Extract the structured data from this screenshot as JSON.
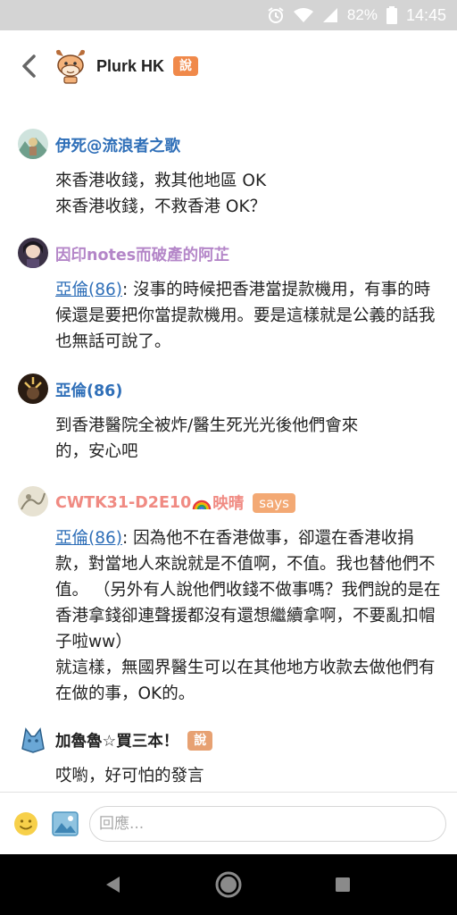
{
  "status_bar": {
    "battery": "82%",
    "time": "14:45",
    "icons": [
      "alarm-icon",
      "wifi-icon",
      "signal-icon",
      "battery-icon"
    ]
  },
  "header": {
    "title": "Plurk HK",
    "qualifier": "說",
    "qualifier_color": "#f0894a"
  },
  "responses": [
    {
      "name": "伊死@流浪者之歌",
      "name_color": "#2f6fb8",
      "lines": [
        "來香港收錢，救其他地區 OK",
        "來香港收錢，不救香港 OK？"
      ]
    },
    {
      "name": "因印notes而破產的阿芷",
      "name_color": "#b486c8",
      "mention": "亞倫(86)",
      "text": ": 沒事的時候把香港當提款機用，有事的時候還是要把你當提款機用。要是這樣就是公義的話我也無話可說了。"
    },
    {
      "name": "亞倫(86)",
      "name_color": "#2f6fb8",
      "lines": [
        "到香港醫院全被炸/醫生死光光後他們會來",
        "的，安心吧"
      ]
    },
    {
      "name": "CWTK31-D2E10",
      "name_suffix": "映晴",
      "name_color": "#f08a82",
      "qualifier": "says",
      "mention": "亞倫(86)",
      "text": ": 因為他不在香港做事，卻還在香港收捐款，對當地人來說就是不值啊，不值。我也替他們不值。 （另外有人說他們收錢不做事嗎？我們說的是在香港拿錢卻連聲援都沒有還想繼續拿啊，不要亂扣帽子啦ww）",
      "text2": "就這樣，無國界醫生可以在其他地方收款去做他們有在做的事，OK的。"
    },
    {
      "name": "加魯魯☆買三本！",
      "name_color": "#222222",
      "qualifier": "說",
      "lines": [
        "哎喲，好可怕的發言"
      ]
    }
  ],
  "input_bar": {
    "placeholder": "回應..."
  },
  "nav": [
    "back-triangle-icon",
    "home-circle-icon",
    "recents-square-icon"
  ]
}
